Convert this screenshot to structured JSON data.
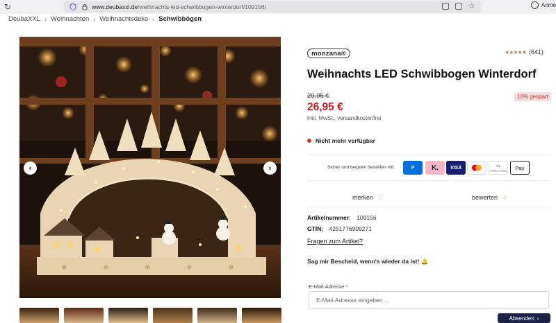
{
  "browser": {
    "url_host": "www.deubaxxl.de",
    "url_path": "/weihnachts-led-schwibbogen-winterdorf/109156/",
    "account_label": "Anme"
  },
  "breadcrumb": [
    "DeubaXXL",
    "Weihnachten",
    "Weihnachtsdeko",
    "Schwibbögen"
  ],
  "gallery": {
    "prev_icon": "‹",
    "next_icon": "›",
    "thumbnail_count": 6
  },
  "product": {
    "brand": "monzana®",
    "rating_count": "(641)",
    "rating_stars": "★★★★★",
    "title": "Weihnachts LED Schwibbogen Winterdorf",
    "old_price": "29,95 €",
    "discount_badge": "10% gespart",
    "price": "26,95 €",
    "tax_note": "inkl. MwSt., versandkostenfrei",
    "availability": "Nicht mehr verfügbar",
    "payment_label": "Sicher und bequem bezahlen mit:",
    "payment_methods": {
      "paypal": "P",
      "klarna": "K.",
      "visa": "VISA",
      "vorkasse": "VORKASSE",
      "applepay": " Pay"
    },
    "actions": {
      "merken": "merken",
      "bewerten": "bewerten"
    },
    "article_number_label": "Artikelnummer:",
    "article_number": "109156",
    "gtin_label": "GTIN:",
    "gtin": "4251776909271",
    "faq_link": "Fragen zum Artikel?",
    "notify_text": "Sag mir Bescheid, wenn's wieder da ist! 🔔",
    "email_label": "E-Mail-Adresse",
    "email_required": "*",
    "email_placeholder": "E-Mail-Adresse eingeben ...",
    "submit_label": "Absenden",
    "submit_icon": "›"
  },
  "colors": {
    "price_red": "#d7141a",
    "button_navy": "#1a2246",
    "star_gold": "#a48a63"
  }
}
